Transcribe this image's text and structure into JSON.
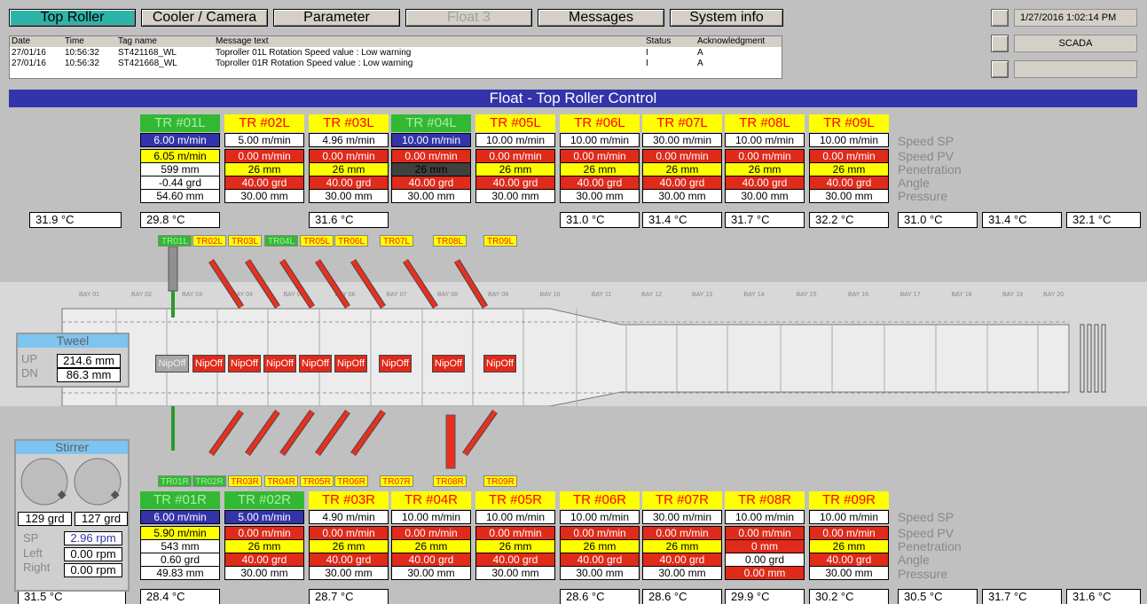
{
  "nav": [
    {
      "label": "Top Roller",
      "state": "active"
    },
    {
      "label": "Cooler / Camera",
      "state": "normal"
    },
    {
      "label": "Parameter",
      "state": "normal"
    },
    {
      "label": "Float 3",
      "state": "disabled"
    },
    {
      "label": "Messages",
      "state": "normal"
    },
    {
      "label": "System info",
      "state": "normal"
    }
  ],
  "status": {
    "datetime": "1/27/2016 1:02:14 PM",
    "system": "SCADA",
    "blank": ""
  },
  "alarm": {
    "headers": [
      "Date",
      "Time",
      "Tag name",
      "Message text",
      "Status",
      "Acknowledgment"
    ],
    "rows": [
      [
        "27/01/16",
        "10:56:32",
        "ST421168_WL",
        "Toproller 01L Rotation Speed value : Low warning",
        "I",
        "A"
      ],
      [
        "27/01/16",
        "10:56:32",
        "ST421668_WL",
        "Toproller 01R Rotation Speed value : Low warning",
        "I",
        "A"
      ]
    ]
  },
  "title": "Float - Top Roller Control",
  "row_labels": {
    "speed_sp": "Speed SP",
    "speed_pv": "Speed PV",
    "penetration": "Penetration",
    "angle": "Angle",
    "pressure": "Pressure"
  },
  "top": {
    "rollers": [
      {
        "name": "TR #01L",
        "head": "g",
        "sp": "6.00 m/min",
        "sp_c": "v-blue",
        "pv": "6.05 m/min",
        "pv_c": "v-yellow",
        "pen": "599  mm",
        "pen_c": "v-white",
        "ang": "-0.44  grd",
        "ang_c": "v-white",
        "pr": "54.60  mm",
        "temp": "29.8   °C"
      },
      {
        "name": "TR #02L",
        "head": "y",
        "sp": "5.00 m/min",
        "sp_c": "v-white",
        "pv": "0.00 m/min",
        "pv_c": "v-red",
        "pen": "26  mm",
        "pen_c": "v-yellow",
        "ang": "40.00  grd",
        "ang_c": "v-red",
        "pr": "30.00  mm",
        "temp": ""
      },
      {
        "name": "TR #03L",
        "head": "y",
        "sp": "4.96 m/min",
        "sp_c": "v-white",
        "pv": "0.00 m/min",
        "pv_c": "v-red",
        "pen": "26  mm",
        "pen_c": "v-yellow",
        "ang": "40.00  grd",
        "ang_c": "v-red",
        "pr": "30.00  mm",
        "temp": "31.6   °C"
      },
      {
        "name": "TR #04L",
        "head": "g",
        "sp": "10.00 m/min",
        "sp_c": "v-blue",
        "pv": "0.00 m/min",
        "pv_c": "v-red",
        "pen": "26  mm",
        "pen_c": "v-dark",
        "ang": "40.00  grd",
        "ang_c": "v-red",
        "pr": "30.00  mm",
        "temp": ""
      },
      {
        "name": "TR #05L",
        "head": "y",
        "sp": "10.00 m/min",
        "sp_c": "v-white",
        "pv": "0.00 m/min",
        "pv_c": "v-red",
        "pen": "26  mm",
        "pen_c": "v-yellow",
        "ang": "40.00  grd",
        "ang_c": "v-red",
        "pr": "30.00  mm",
        "temp": ""
      },
      {
        "name": "TR #06L",
        "head": "y",
        "sp": "10.00 m/min",
        "sp_c": "v-white",
        "pv": "0.00 m/min",
        "pv_c": "v-red",
        "pen": "26  mm",
        "pen_c": "v-yellow",
        "ang": "40.00  grd",
        "ang_c": "v-red",
        "pr": "30.00  mm",
        "temp": "31.0   °C"
      },
      {
        "name": "TR #07L",
        "head": "y",
        "sp": "30.00 m/min",
        "sp_c": "v-white",
        "pv": "0.00 m/min",
        "pv_c": "v-red",
        "pen": "26  mm",
        "pen_c": "v-yellow",
        "ang": "40.00  grd",
        "ang_c": "v-red",
        "pr": "30.00  mm",
        "temp": "31.4   °C"
      },
      {
        "name": "TR #08L",
        "head": "y",
        "sp": "10.00 m/min",
        "sp_c": "v-white",
        "pv": "0.00 m/min",
        "pv_c": "v-red",
        "pen": "26  mm",
        "pen_c": "v-yellow",
        "ang": "40.00  grd",
        "ang_c": "v-red",
        "pr": "30.00  mm",
        "temp": "31.7   °C"
      },
      {
        "name": "TR #09L",
        "head": "y",
        "sp": "10.00 m/min",
        "sp_c": "v-white",
        "pv": "0.00 m/min",
        "pv_c": "v-red",
        "pen": "26  mm",
        "pen_c": "v-yellow",
        "ang": "40.00  grd",
        "ang_c": "v-red",
        "pr": "30.00  mm",
        "temp": "32.2   °C"
      }
    ],
    "temp_left": "31.9   °C",
    "temps_right": [
      "31.0   °C",
      "31.4   °C",
      "32.1   °C"
    ],
    "tags": [
      {
        "t": "TR01L",
        "g": true
      },
      {
        "t": "TR02L",
        "g": false
      },
      {
        "t": "TR03L",
        "g": false
      },
      {
        "t": "TR04L",
        "g": true
      },
      {
        "t": "TR05L",
        "g": false
      },
      {
        "t": "TR06L",
        "g": false
      },
      {
        "t": "TR07L",
        "g": false
      },
      {
        "t": "TR08L",
        "g": false
      },
      {
        "t": "TR09L",
        "g": false
      }
    ]
  },
  "bottom": {
    "rollers": [
      {
        "name": "TR #01R",
        "head": "g",
        "sp": "6.00 m/min",
        "sp_c": "v-blue",
        "pv": "5.90 m/min",
        "pv_c": "v-yellow",
        "pen": "543  mm",
        "pen_c": "v-white",
        "ang": "0.60  grd",
        "ang_c": "v-white",
        "pr": "49.83  mm",
        "pr_c": "v-white",
        "temp": "28.4   °C"
      },
      {
        "name": "TR #02R",
        "head": "g",
        "sp": "5.00 m/min",
        "sp_c": "v-blue",
        "pv": "0.00 m/min",
        "pv_c": "v-red",
        "pen": "26  mm",
        "pen_c": "v-yellow",
        "ang": "40.00  grd",
        "ang_c": "v-red",
        "pr": "30.00  mm",
        "pr_c": "v-white",
        "temp": ""
      },
      {
        "name": "TR #03R",
        "head": "y",
        "sp": "4.90 m/min",
        "sp_c": "v-white",
        "pv": "0.00 m/min",
        "pv_c": "v-red",
        "pen": "26  mm",
        "pen_c": "v-yellow",
        "ang": "40.00  grd",
        "ang_c": "v-red",
        "pr": "30.00  mm",
        "pr_c": "v-white",
        "temp": "28.7   °C"
      },
      {
        "name": "TR #04R",
        "head": "y",
        "sp": "10.00 m/min",
        "sp_c": "v-white",
        "pv": "0.00 m/min",
        "pv_c": "v-red",
        "pen": "26  mm",
        "pen_c": "v-yellow",
        "ang": "40.00  grd",
        "ang_c": "v-red",
        "pr": "30.00  mm",
        "pr_c": "v-white",
        "temp": ""
      },
      {
        "name": "TR #05R",
        "head": "y",
        "sp": "10.00 m/min",
        "sp_c": "v-white",
        "pv": "0.00 m/min",
        "pv_c": "v-red",
        "pen": "26  mm",
        "pen_c": "v-yellow",
        "ang": "40.00  grd",
        "ang_c": "v-red",
        "pr": "30.00  mm",
        "pr_c": "v-white",
        "temp": ""
      },
      {
        "name": "TR #06R",
        "head": "y",
        "sp": "10.00 m/min",
        "sp_c": "v-white",
        "pv": "0.00 m/min",
        "pv_c": "v-red",
        "pen": "26  mm",
        "pen_c": "v-yellow",
        "ang": "40.00  grd",
        "ang_c": "v-red",
        "pr": "30.00  mm",
        "pr_c": "v-white",
        "temp": "28.6   °C"
      },
      {
        "name": "TR #07R",
        "head": "y",
        "sp": "30.00 m/min",
        "sp_c": "v-white",
        "pv": "0.00 m/min",
        "pv_c": "v-red",
        "pen": "26  mm",
        "pen_c": "v-yellow",
        "ang": "40.00  grd",
        "ang_c": "v-red",
        "pr": "30.00  mm",
        "pr_c": "v-white",
        "temp": "28.6   °C"
      },
      {
        "name": "TR #08R",
        "head": "y",
        "sp": "10.00 m/min",
        "sp_c": "v-white",
        "pv": "0.00 m/min",
        "pv_c": "v-red",
        "pen": "0  mm",
        "pen_c": "v-red",
        "ang": "0.00  grd",
        "ang_c": "v-white",
        "pr": "0.00  mm",
        "pr_c": "v-red",
        "temp": "29.9   °C"
      },
      {
        "name": "TR #09R",
        "head": "y",
        "sp": "10.00 m/min",
        "sp_c": "v-white",
        "pv": "0.00 m/min",
        "pv_c": "v-red",
        "pen": "26  mm",
        "pen_c": "v-yellow",
        "ang": "40.00  grd",
        "ang_c": "v-red",
        "pr": "30.00  mm",
        "pr_c": "v-white",
        "temp": "30.2   °C"
      }
    ],
    "temp_left": "31.5   °C",
    "temps_right": [
      "30.5   °C",
      "31.7   °C",
      "31.6   °C"
    ],
    "tags": [
      {
        "t": "TR01R",
        "g": true
      },
      {
        "t": "TR02R",
        "g": true
      },
      {
        "t": "TR03R",
        "g": false
      },
      {
        "t": "TR04R",
        "g": false
      },
      {
        "t": "TR05R",
        "g": false
      },
      {
        "t": "TR06R",
        "g": false
      },
      {
        "t": "TR07R",
        "g": false
      },
      {
        "t": "TR08R",
        "g": false
      },
      {
        "t": "TR09R",
        "g": false
      }
    ]
  },
  "bays": [
    "BAY 01",
    "BAY 02",
    "BAY 03",
    "BAY 04",
    "BAY 05",
    "BAY 06",
    "BAY 07",
    "BAY 08",
    "BAY 09",
    "BAY 10",
    "BAY 11",
    "BAY 12",
    "BAY 13",
    "BAY 14",
    "BAY 15",
    "BAY 16",
    "BAY 17",
    "BAY 18",
    "BAY 19",
    "BAY 20"
  ],
  "nip_label": "NipOff",
  "tweel": {
    "title": "Tweel",
    "up_label": "UP",
    "up": "214.6 mm",
    "dn_label": "DN",
    "dn": "86.3 mm"
  },
  "stirrer": {
    "title": "Stirrer",
    "left_angle": "129 grd",
    "right_angle": "127 grd",
    "sp_label": "SP",
    "sp": "2.96 rpm",
    "left_label": "Left",
    "left": "0.00 rpm",
    "right_label": "Right",
    "right": "0.00 rpm"
  },
  "colors": {
    "accent": "#3333aa",
    "active_nav": "#2eb3a8",
    "alarm_red": "#e02a1a",
    "warn_yellow": "#ffff00",
    "ok_green": "#33b833"
  }
}
